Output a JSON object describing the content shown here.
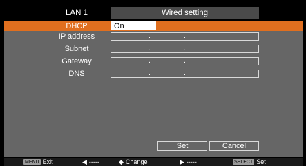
{
  "header": {
    "left_label": "LAN 1",
    "right_title": "Wired setting"
  },
  "rows": [
    {
      "label": "DHCP",
      "value": "On"
    },
    {
      "label": "IP address",
      "dots": [
        ".",
        ".",
        "."
      ]
    },
    {
      "label": "Subnet",
      "dots": [
        ".",
        ".",
        "."
      ]
    },
    {
      "label": "Gateway",
      "dots": [
        ".",
        ".",
        "."
      ]
    },
    {
      "label": "DNS",
      "dots": [
        ".",
        ".",
        "."
      ]
    }
  ],
  "buttons": {
    "set": "Set",
    "cancel": "Cancel"
  },
  "footer": {
    "menu_key": "MENU",
    "exit": "Exit",
    "left_arrow": "◀",
    "left_dash": "-----",
    "updown": "◆",
    "change": "Change",
    "right_arrow": "▶",
    "right_dash": "-----",
    "select_key": "SELECT",
    "set": "Set"
  },
  "colors": {
    "highlight": "#e06f1f",
    "panel": "#666666"
  }
}
